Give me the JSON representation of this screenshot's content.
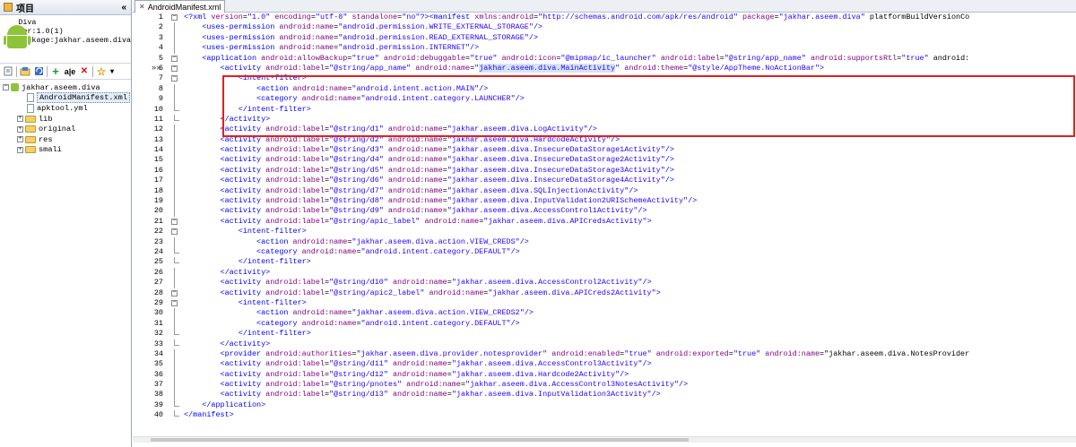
{
  "left_panel": {
    "title": "项目",
    "collapse_label": "«",
    "app_name": "Diva",
    "app_version": "Ver:1.0(1)",
    "app_package": "Package:jakhar.aseem.diva",
    "tree": {
      "root": "jakhar.aseem.diva",
      "manifest": "AndroidManifest.xml",
      "apktool": "apktool.yml",
      "lib": "lib",
      "original": "original",
      "res": "res",
      "smali": "smali"
    },
    "toolbar": {
      "add_label": "+",
      "abc_label": "a|e",
      "delete_label": "✕",
      "star_label": "☆",
      "dropdown_label": "▾"
    }
  },
  "tab": {
    "label": "AndroidManifest.xml",
    "close": "✕"
  },
  "editor": {
    "line_numbers": [
      "1",
      "2",
      "3",
      "4",
      "5",
      "6",
      "7",
      "8",
      "9",
      "10",
      "11",
      "12",
      "13",
      "14",
      "15",
      "16",
      "17",
      "18",
      "19",
      "20",
      "21",
      "22",
      "23",
      "24",
      "25",
      "26",
      "27",
      "28",
      "29",
      "30",
      "31",
      "32",
      "33",
      "34",
      "35",
      "36",
      "37",
      "38",
      "39",
      "40"
    ],
    "gutter_arrows": "»»"
  }
}
